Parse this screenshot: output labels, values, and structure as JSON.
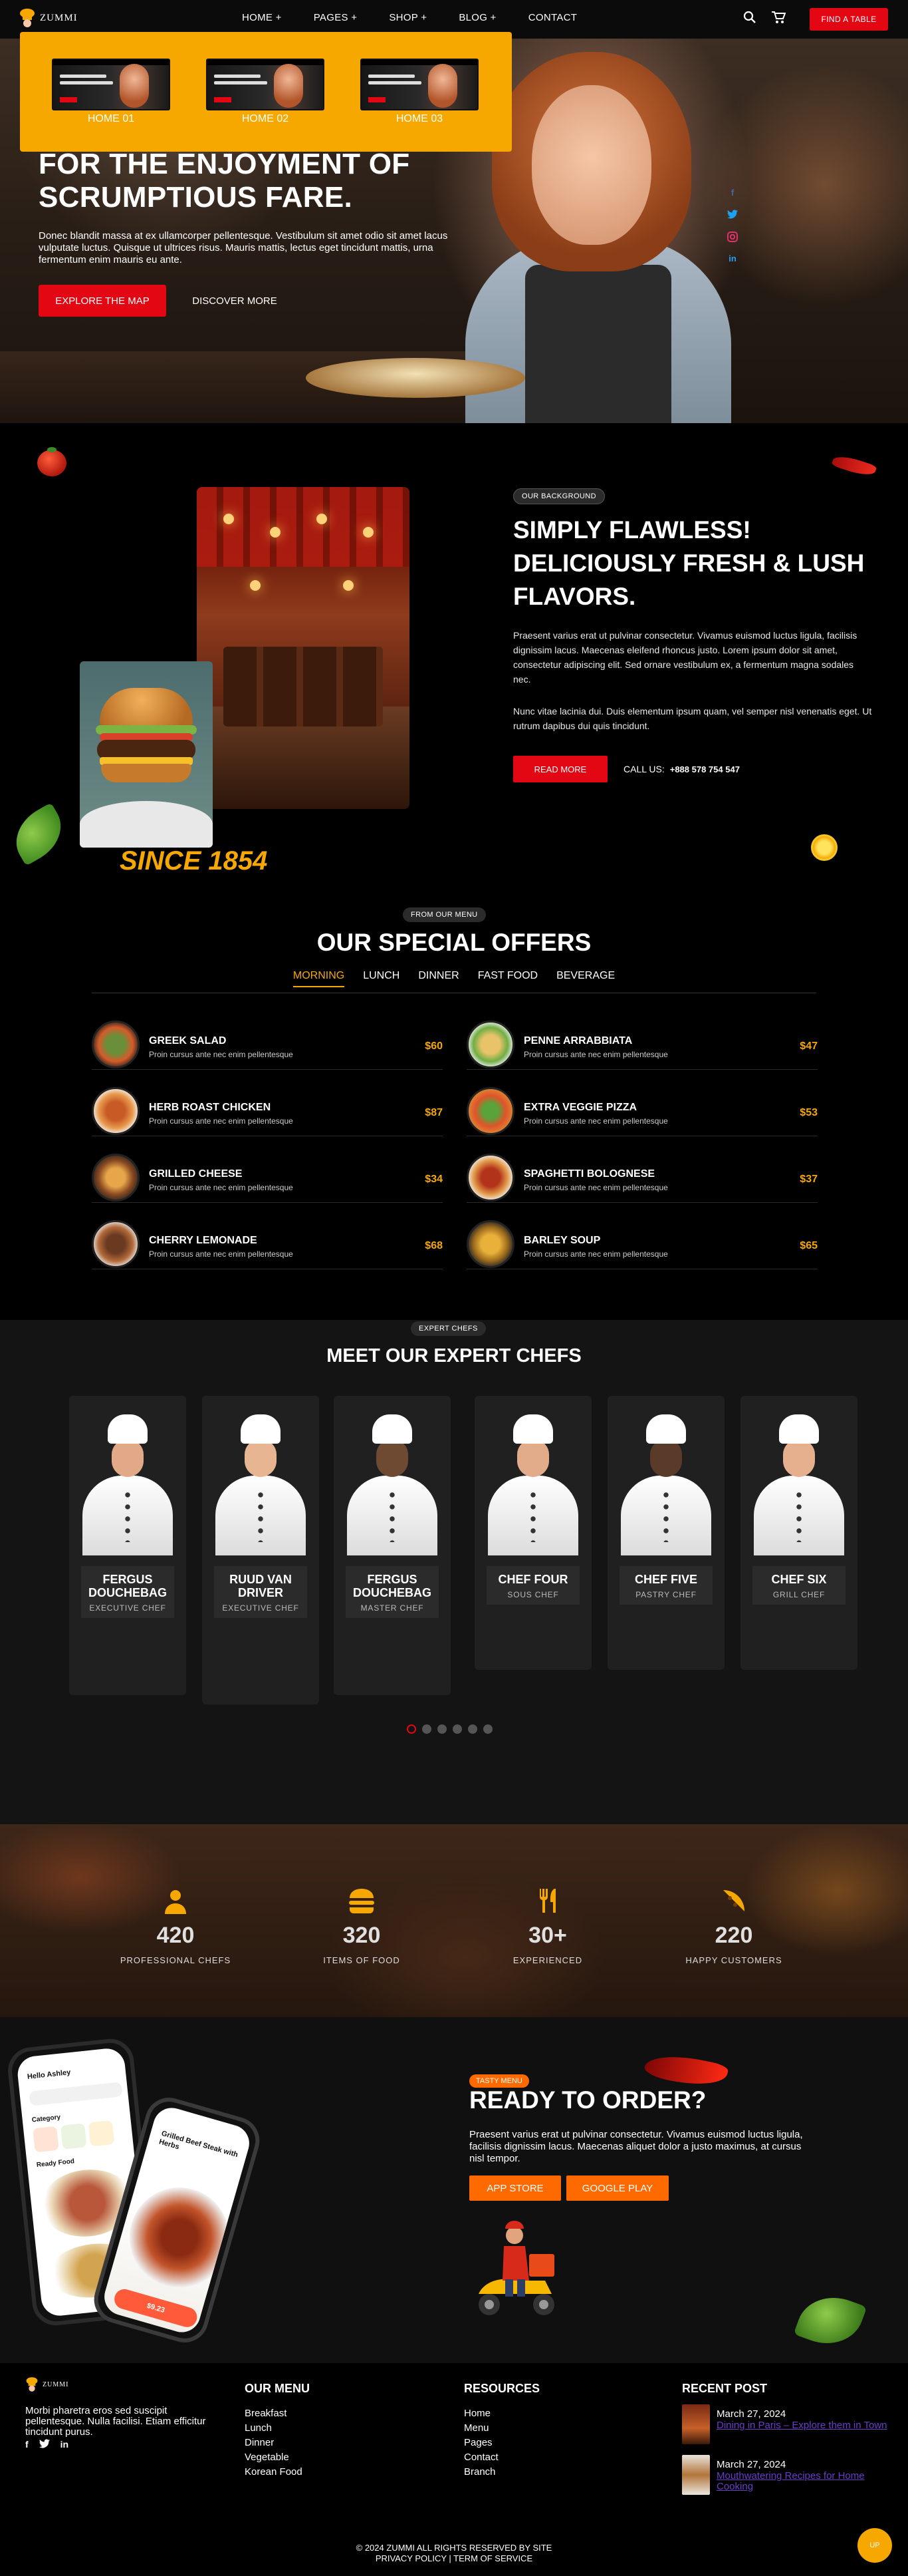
{
  "header": {
    "logo_text": "ZUMMI",
    "nav": [
      "HOME +",
      "PAGES +",
      "SHOP +",
      "BLOG +",
      "CONTACT"
    ],
    "find_table": "FIND A TABLE",
    "icons": [
      "search-icon",
      "cart-icon"
    ]
  },
  "home_dropdown": {
    "items": [
      "HOME 01",
      "HOME 02",
      "HOME 03"
    ]
  },
  "hero": {
    "title": "FOR THE ENJOYMENT OF SCRUMPTIOUS FARE.",
    "text": "Donec blandit massa at ex ullamcorper pellentesque. Vestibulum sit amet odio sit amet lacus vulputate luctus. Quisque ut ultrices risus. Mauris mattis, lectus eget tincidunt mattis, urna fermentum enim mauris eu ante.",
    "btn_explore": "EXPLORE THE MAP",
    "btn_discover": "DISCOVER MORE",
    "social": [
      "facebook-icon",
      "twitter-icon",
      "instagram-icon",
      "linkedin-icon"
    ]
  },
  "about": {
    "pill": "OUR BACKGROUND",
    "title": "SIMPLY FLAWLESS! DELICIOUSLY FRESH & LUSH FLAVORS.",
    "p1": "Praesent varius erat ut pulvinar consectetur. Vivamus euismod luctus ligula, facilisis dignissim lacus. Maecenas eleifend rhoncus justo. Lorem ipsum dolor sit amet, consectetur adipiscing elit. Sed ornare vestibulum ex, a fermentum magna sodales nec.",
    "p2": "Nunc vitae lacinia dui. Duis elementum ipsum quam, vel semper nisl venenatis eget. Ut rutrum dapibus dui quis tincidunt.",
    "read_more": "READ MORE",
    "call_label": "CALL US:",
    "phone": "+888 578 754 547",
    "since": "SINCE 1854"
  },
  "menu": {
    "pill": "FROM OUR MENU",
    "title": "OUR SPECIAL OFFERS",
    "tabs": [
      "MORNING",
      "LUNCH",
      "DINNER",
      "FAST FOOD",
      "BEVERAGE"
    ],
    "active_tab": "MORNING",
    "items": [
      {
        "name": "GREEK SALAD",
        "desc": "Proin cursus ante nec enim pellentesque",
        "price": "$60"
      },
      {
        "name": "PENNE ARRABBIATA",
        "desc": "Proin cursus ante nec enim pellentesque",
        "price": "$47"
      },
      {
        "name": "HERB ROAST CHICKEN",
        "desc": "Proin cursus ante nec enim pellentesque",
        "price": "$87"
      },
      {
        "name": "EXTRA VEGGIE PIZZA",
        "desc": "Proin cursus ante nec enim pellentesque",
        "price": "$53"
      },
      {
        "name": "GRILLED CHEESE",
        "desc": "Proin cursus ante nec enim pellentesque",
        "price": "$34"
      },
      {
        "name": "SPAGHETTI BOLOGNESE",
        "desc": "Proin cursus ante nec enim pellentesque",
        "price": "$37"
      },
      {
        "name": "CHERRY LEMONADE",
        "desc": "Proin cursus ante nec enim pellentesque",
        "price": "$68"
      },
      {
        "name": "BARLEY SOUP",
        "desc": "Proin cursus ante nec enim pellentesque",
        "price": "$65"
      }
    ]
  },
  "chefs": {
    "pill": "EXPERT CHEFS",
    "title": "MEET OUR EXPERT CHEFS",
    "list": [
      {
        "name": "FERGUS DOUCHEBAG",
        "role": "EXECUTIVE CHEF"
      },
      {
        "name": "RUUD VAN DRIVER",
        "role": "EXECUTIVE CHEF"
      },
      {
        "name": "FERGUS DOUCHEBAG",
        "role": "MASTER CHEF"
      },
      {
        "name": "CHEF FOUR",
        "role": "SOUS CHEF"
      },
      {
        "name": "CHEF FIVE",
        "role": "PASTRY CHEF"
      },
      {
        "name": "CHEF SIX",
        "role": "GRILL CHEF"
      }
    ],
    "dots": 6,
    "active_dot": 0
  },
  "stats": [
    {
      "icon": "chef-icon",
      "value": "420",
      "label": "PROFESSIONAL CHEFS"
    },
    {
      "icon": "burger-icon",
      "value": "320",
      "label": "ITEMS OF FOOD"
    },
    {
      "icon": "utensils-icon",
      "value": "30+",
      "label": "EXPERIENCED"
    },
    {
      "icon": "pizza-icon",
      "value": "220",
      "label": "HAPPY CUSTOMERS"
    }
  ],
  "order": {
    "pill": "TASTY MENU",
    "title": "READY TO ORDER?",
    "text": "Praesent varius erat ut pulvinar consectetur. Vivamus euismod luctus ligula, facilisis dignissim lacus. Maecenas aliquet dolor a justo maximus, at cursus nisl tempor.",
    "app_store": "APP STORE",
    "google_play": "GOOGLE PLAY",
    "phone_greeting": "Hello Ashley",
    "phone_category": "Category",
    "phone_ready": "Ready Food",
    "phone_dish": "Grilled Beef Steak with Herbs",
    "phone_price": "$9.23"
  },
  "footer": {
    "logo_text": "ZUMMI",
    "about": "Morbi pharetra eros sed suscipit pellentesque. Nulla facilisi. Etiam efficitur tincidunt purus.",
    "social": [
      "facebook-icon",
      "twitter-icon",
      "linkedin-icon"
    ],
    "menu_title": "OUR MENU",
    "menu_links": [
      "Breakfast",
      "Lunch",
      "Dinner",
      "Vegetable",
      "Korean Food"
    ],
    "res_title": "RESOURCES",
    "res_links": [
      "Home",
      "Menu",
      "Pages",
      "Contact",
      "Branch"
    ],
    "recent_title": "RECENT POST",
    "posts": [
      {
        "date": "March 27, 2024",
        "title": "Dining in Paris – Explore them in Town"
      },
      {
        "date": "March 27, 2024",
        "title": "Mouthwatering Recipes for Home Cooking"
      }
    ],
    "copyright_1": "© 2024 ZUMMI ALL RIGHTS RESERVED BY SITE",
    "copyright_2": "PRIVACY POLICY | TERM OF SERVICE",
    "scroll_top": "UP"
  },
  "colors": {
    "accent": "#f6a800",
    "red": "#e30613",
    "orange": "#ff6a00"
  }
}
